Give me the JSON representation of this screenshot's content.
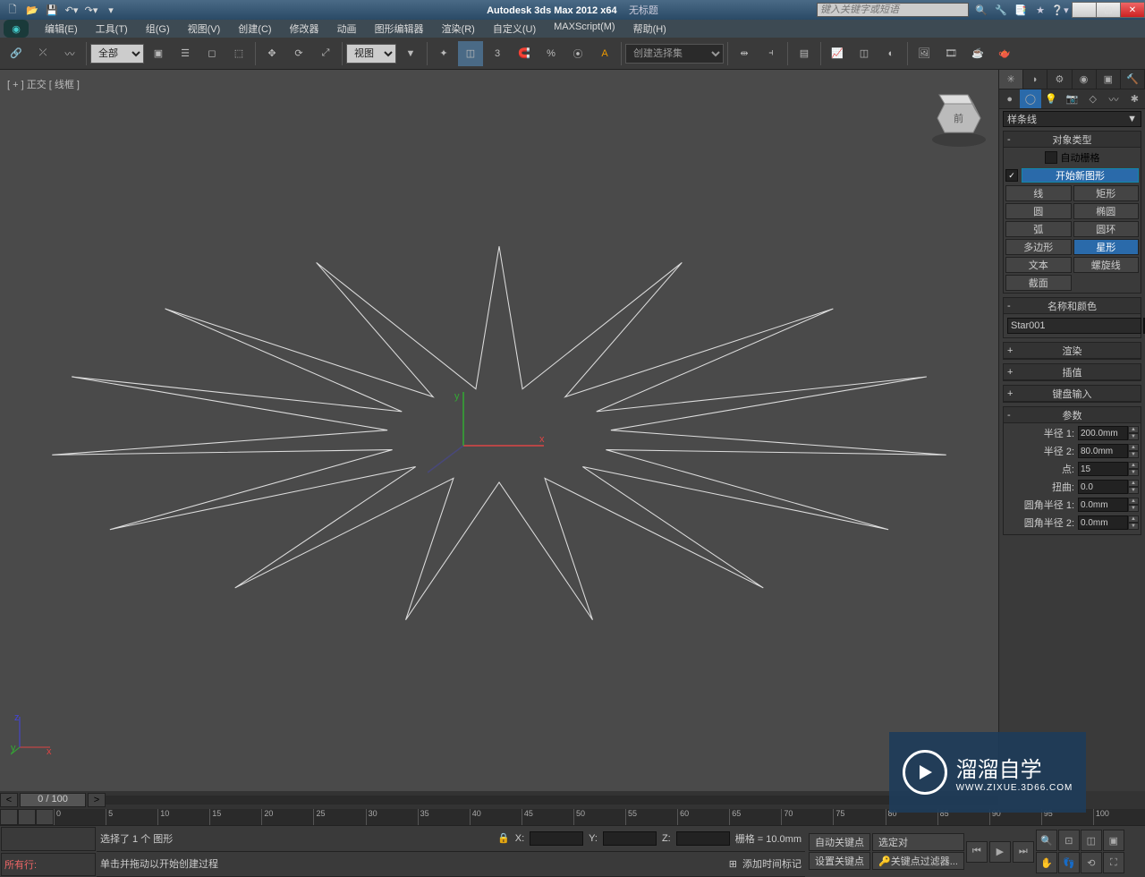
{
  "title": {
    "app": "Autodesk 3ds Max  2012 x64",
    "doc": "无标题"
  },
  "search_placeholder": "键入关键字或短语",
  "menu": [
    "编辑(E)",
    "工具(T)",
    "组(G)",
    "视图(V)",
    "创建(C)",
    "修改器",
    "动画",
    "图形编辑器",
    "渲染(R)",
    "自定义(U)",
    "MAXScript(M)",
    "帮助(H)"
  ],
  "filter_dropdown": "全部",
  "view_dropdown": "视图",
  "namedset_placeholder": "创建选择集",
  "viewport_label": "[ + ] 正交 [ 线框 ]",
  "cmd_dropdown": "样条线",
  "rollouts": {
    "object_type": {
      "title": "对象类型",
      "autogrid": "自动栅格",
      "newshape": "开始新图形",
      "buttons": [
        "线",
        "矩形",
        "圆",
        "椭圆",
        "弧",
        "圆环",
        "多边形",
        "星形",
        "文本",
        "螺旋线",
        "截面",
        ""
      ]
    },
    "name_color": {
      "title": "名称和颜色",
      "name": "Star001",
      "color": "#b8c848"
    },
    "render": "渲染",
    "interp": "插值",
    "keyboard": "键盘输入",
    "params": {
      "title": "参数",
      "rows": [
        {
          "label": "半径 1:",
          "value": "200.0mm"
        },
        {
          "label": "半径 2:",
          "value": "80.0mm"
        },
        {
          "label": "点:",
          "value": "15"
        },
        {
          "label": "扭曲:",
          "value": "0.0"
        },
        {
          "label": "圆角半径 1:",
          "value": "0.0mm"
        },
        {
          "label": "圆角半径 2:",
          "value": "0.0mm"
        }
      ]
    }
  },
  "time_slider": "0 / 100",
  "track_ticks": [
    "0",
    "5",
    "10",
    "15",
    "20",
    "25",
    "30",
    "35",
    "40",
    "45",
    "50",
    "55",
    "60",
    "65",
    "70",
    "75",
    "80",
    "85",
    "90",
    "95",
    "100"
  ],
  "status": {
    "left2": "所有行:",
    "prompt1": "选择了 1 个 图形",
    "prompt2": "单击并拖动以开始创建过程",
    "xlabel": "X:",
    "ylabel": "Y:",
    "zlabel": "Z:",
    "grid": "栅格 = 10.0mm",
    "addtime": "添加时间标记",
    "autokey": "自动关键点",
    "setkey": "设置关键点",
    "selfilter": "选定对",
    "keyfilter": "关键点过滤器..."
  },
  "watermark": {
    "big": "溜溜自学",
    "small": "WWW.ZIXUE.3D66.COM"
  }
}
